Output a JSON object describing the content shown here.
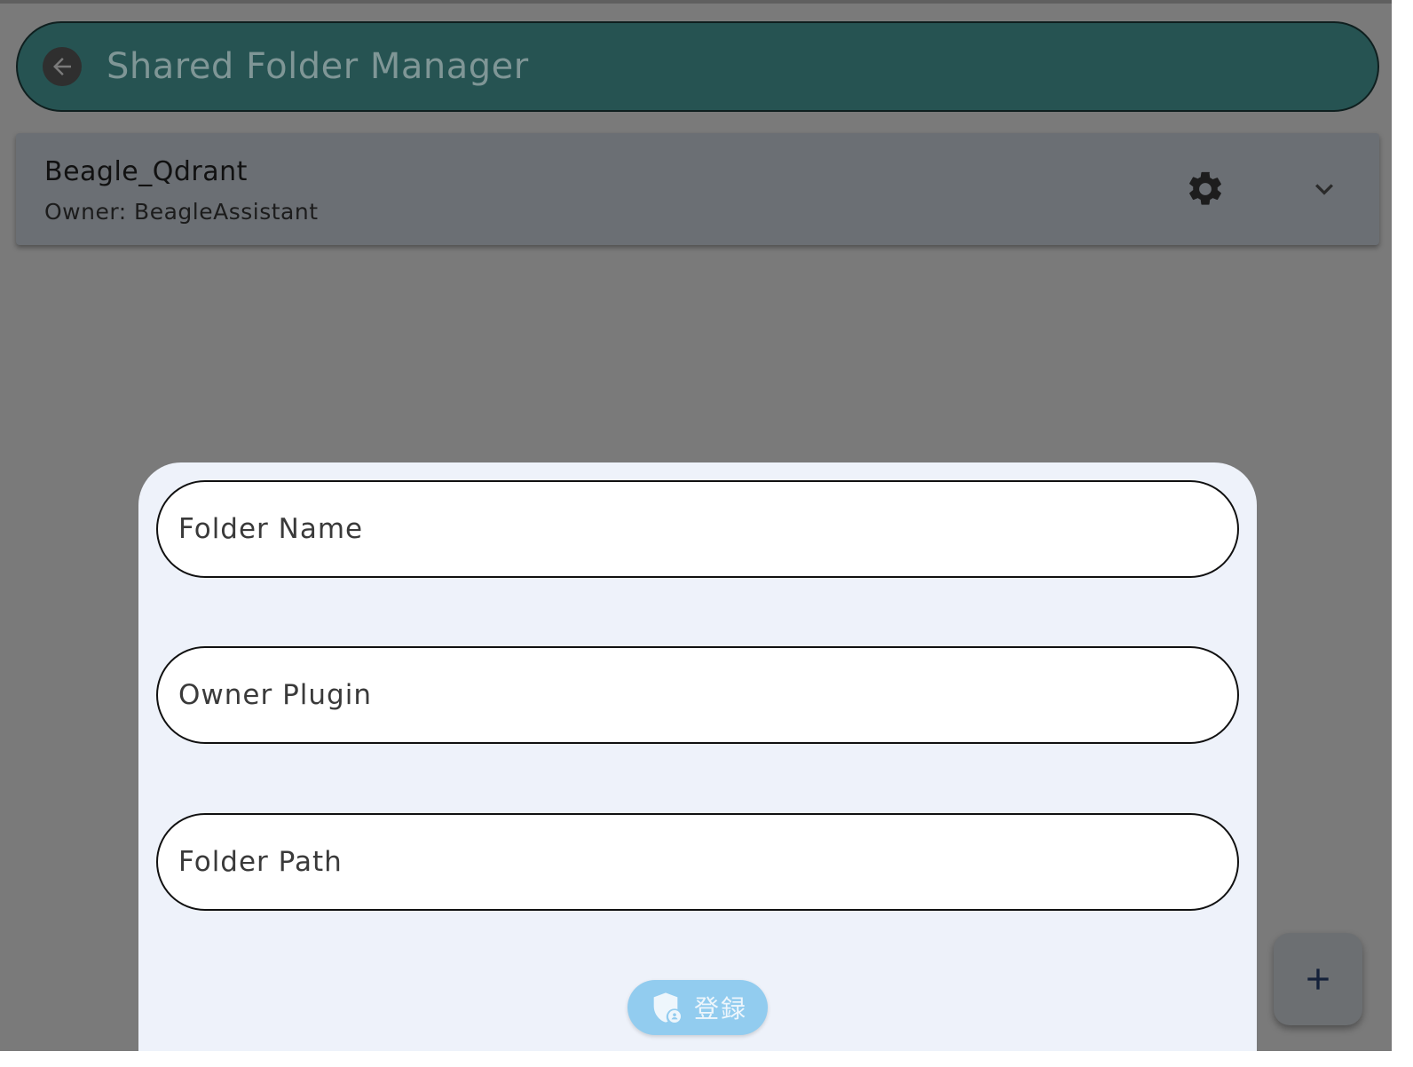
{
  "app_bar": {
    "title": "Shared Folder Manager",
    "back_icon": "arrow-left-icon",
    "background": "#265352"
  },
  "folders": [
    {
      "name": "Beagle_Qdrant",
      "owner": "Owner: BeagleAssistant",
      "settings_icon": "gear-icon",
      "expand_icon": "chevron-down-icon"
    }
  ],
  "form": {
    "folder_name_label": "Folder Name",
    "owner_plugin_label": "Owner Plugin",
    "folder_path_label": "Folder Path",
    "register_label": "登録",
    "register_icon": "shield-person-icon",
    "register_color": "#92ccef"
  },
  "fab": {
    "icon": "plus-icon"
  }
}
